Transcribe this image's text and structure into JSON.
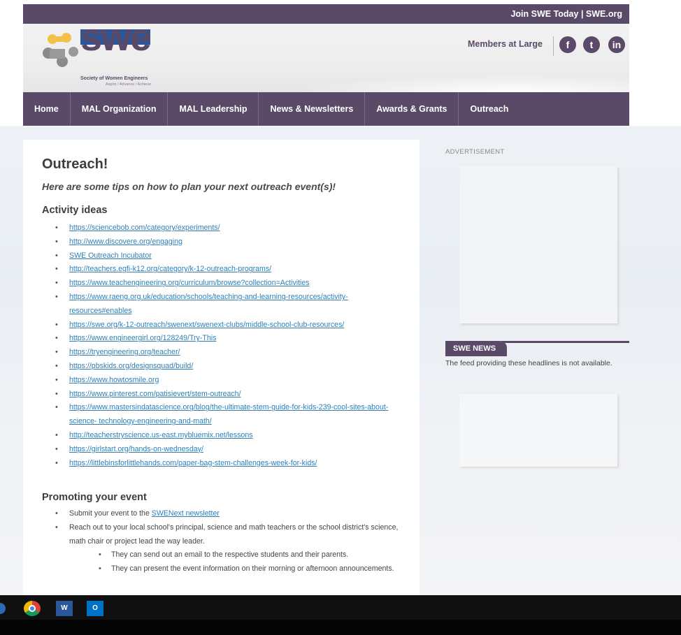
{
  "topbar": {
    "links": "Join SWE Today | SWE.org"
  },
  "logo": {
    "word": "swe",
    "tagline1": "Society of Women Engineers",
    "tagline2": "Aspire / Advance / Achieve"
  },
  "header": {
    "members_label": "Members at Large",
    "social": [
      {
        "icon": "facebook-icon",
        "glyph": "f"
      },
      {
        "icon": "twitter-icon",
        "glyph": "t"
      },
      {
        "icon": "linkedin-icon",
        "glyph": "in"
      }
    ]
  },
  "nav": [
    "Home",
    "MAL Organization",
    "MAL Leadership",
    "News & Newsletters",
    "Awards & Grants",
    "Outreach"
  ],
  "main": {
    "title": "Outreach!",
    "subtitle": "Here are some tips on how to plan your next outreach event(s)!",
    "activity_heading": "Activity ideas",
    "activity_links": [
      "https://sciencebob.com/category/experiments/",
      "http://www.discovere.org/engaging",
      "SWE Outreach Incubator",
      "http://teachers.egfi-k12.org/category/k-12-outreach-programs/",
      "https://www.teachengineering.org/curriculum/browse?collection=Activities",
      "https://www.raeng.org.uk/education/schools/teaching-and-learning-resources/activity-resources#enables",
      "https://swe.org/k-12-outreach/swenext/swenext-clubs/middle-school-club-resources/",
      "https://www.engineergirl.org/128249/Try-This",
      "https://tryengineering.org/teacher/",
      "https://pbskids.org/designsquad/build/",
      "https://www.howtosmile.org",
      "https://www.pinterest.com/patisievert/stem-outreach/",
      "https://www.mastersindatascience.org/blog/the-ultimate-stem-guide-for-kids-239-cool-sites-about-science- technology-engineering-and-math/",
      "http://teacherstryscience.us-east.mybluemix.net/lessons",
      "https://girlstart.org/hands-on-wednesday/",
      "https://littlebinsforlittlehands.com/paper-bag-stem-challenges-week-for-kids/"
    ],
    "promo_heading": "Promoting your event",
    "promo": {
      "item1_prefix": "Submit your event to the ",
      "item1_link": "SWENext newsletter",
      "item2": "Reach out to your local school's principal, science and math teachers or the school district's science, math chair or project lead the way leader.",
      "sub1": "They can send out an email to the respective students and their parents.",
      "sub2": "They can present the event information on their morning or afternoon announcements."
    }
  },
  "sidebar": {
    "ad_label": "ADVERTISEMENT",
    "news_title": "SWE NEWS",
    "news_text": "The feed providing these headlines is not available."
  },
  "taskbar": {
    "apps": [
      "chrome-icon",
      "word-icon",
      "outlook-icon"
    ]
  }
}
